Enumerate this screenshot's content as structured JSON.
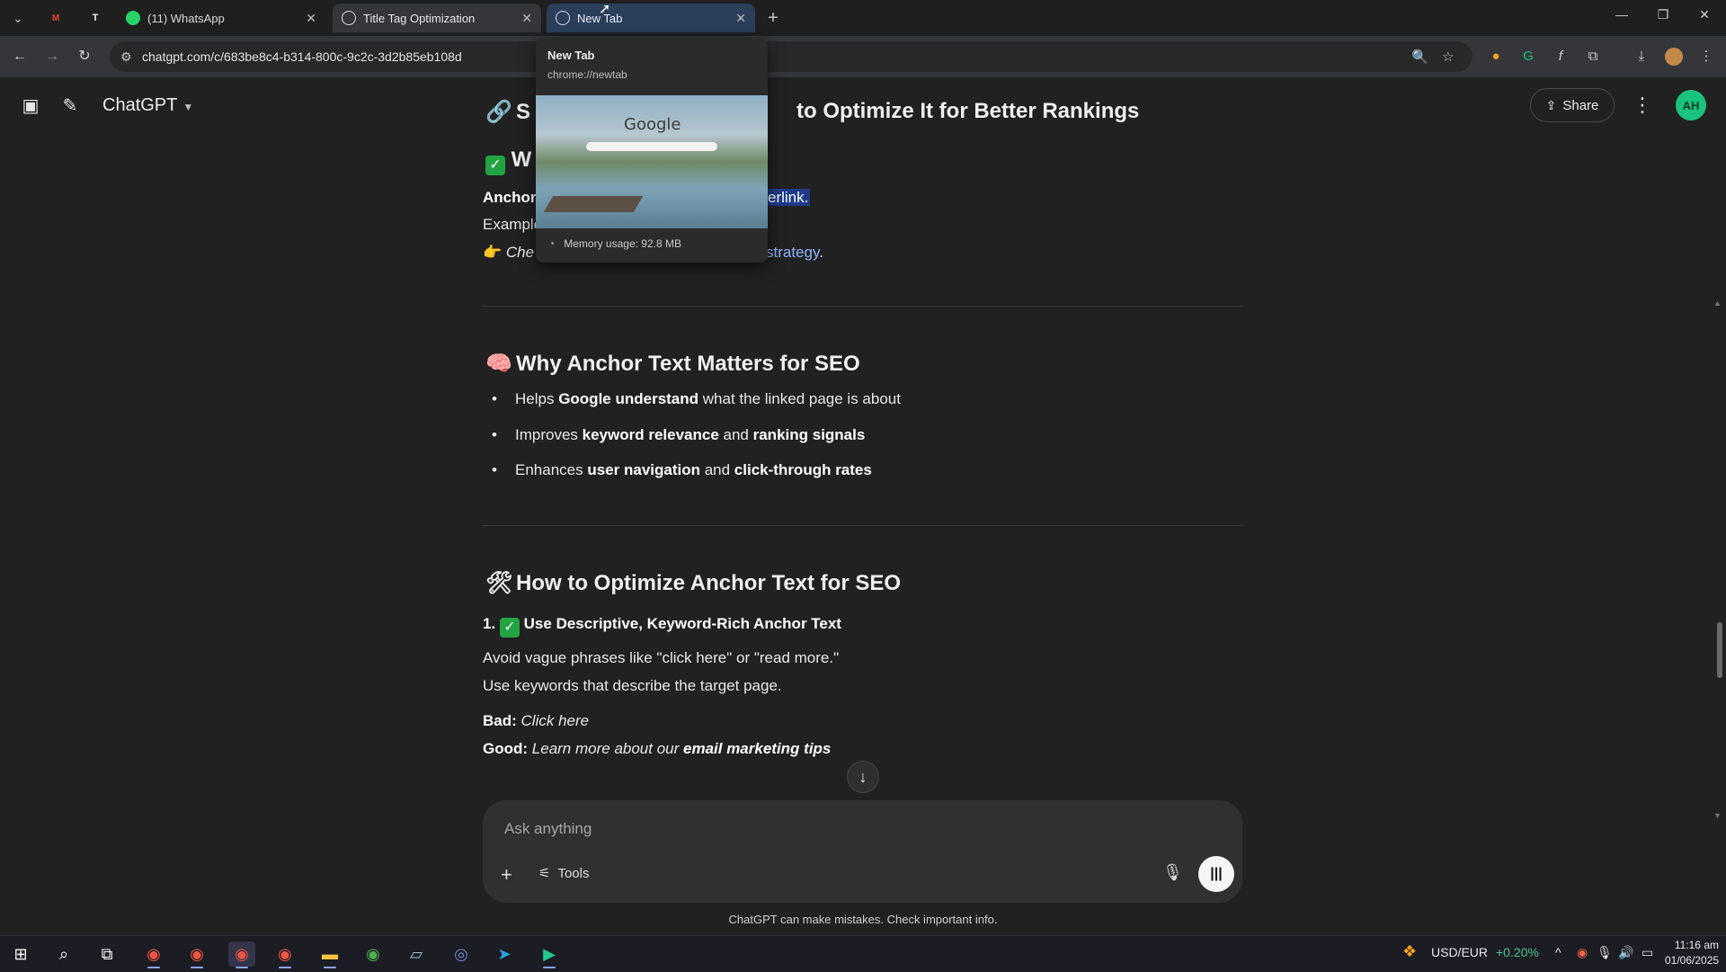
{
  "tabs": [
    {
      "id": "gmail",
      "label": "",
      "pinned": true
    },
    {
      "id": "trello",
      "label": "",
      "pinned": true
    },
    {
      "id": "whatsapp",
      "label": "(11) WhatsApp"
    },
    {
      "id": "chatgpt",
      "label": "Title Tag Optimization"
    },
    {
      "id": "newtab",
      "label": "New Tab"
    }
  ],
  "address_bar": {
    "url": "chatgpt.com/c/683be8c4-b314-800c-9c2c-3d2b85eb108d"
  },
  "hover_card": {
    "title": "New Tab",
    "url": "chrome://newtab",
    "thumb_logo": "Google",
    "memory": "Memory usage: 92.8 MB"
  },
  "app": {
    "brand": "ChatGPT",
    "share_label": "Share",
    "avatar_initials": "AH"
  },
  "content": {
    "heading_top_left": "S",
    "heading_top_right": "to Optimize It for Better Rankings",
    "heading_w": "W",
    "anchor_label": "Anchor",
    "anchor_tail": "erlink.",
    "example_label": "Example",
    "check_prefix": "Che",
    "check_tail": "strategy",
    "check_dot": ".",
    "why_heading": "Why Anchor Text Matters for SEO",
    "why_bullets": [
      {
        "pre": "Helps ",
        "b1": "Google understand",
        "mid": " what the linked page is about",
        "b2": "",
        "post": ""
      },
      {
        "pre": "Improves ",
        "b1": "keyword relevance",
        "mid": " and ",
        "b2": "ranking signals",
        "post": ""
      },
      {
        "pre": "Enhances ",
        "b1": "user navigation",
        "mid": " and ",
        "b2": "click-through rates",
        "post": ""
      }
    ],
    "how_heading": "How to Optimize Anchor Text for SEO",
    "step1_num": "1.",
    "step1_title": "Use Descriptive, Keyword-Rich Anchor Text",
    "step1_line1": "Avoid vague phrases like \"click here\" or \"read more.\"",
    "step1_line2": "Use keywords that describe the target page.",
    "bad_label": "Bad:",
    "bad_value": "Click here",
    "good_label": "Good:",
    "good_value_pre": "Learn more about our ",
    "good_value_bold": "email marketing tips"
  },
  "composer": {
    "placeholder": "Ask anything",
    "tools_label": "Tools"
  },
  "disclaimer": "ChatGPT can make mistakes. Check important info.",
  "taskbar": {
    "ticker": "USD/EUR",
    "change": "+0.20%",
    "change_color": "#4cc38a",
    "time": "11:16 am",
    "date": "01/06/2025"
  },
  "colors": {
    "highlight": "#1e3a8a",
    "link": "#8fb3ff",
    "avatar": "#19c37d"
  }
}
